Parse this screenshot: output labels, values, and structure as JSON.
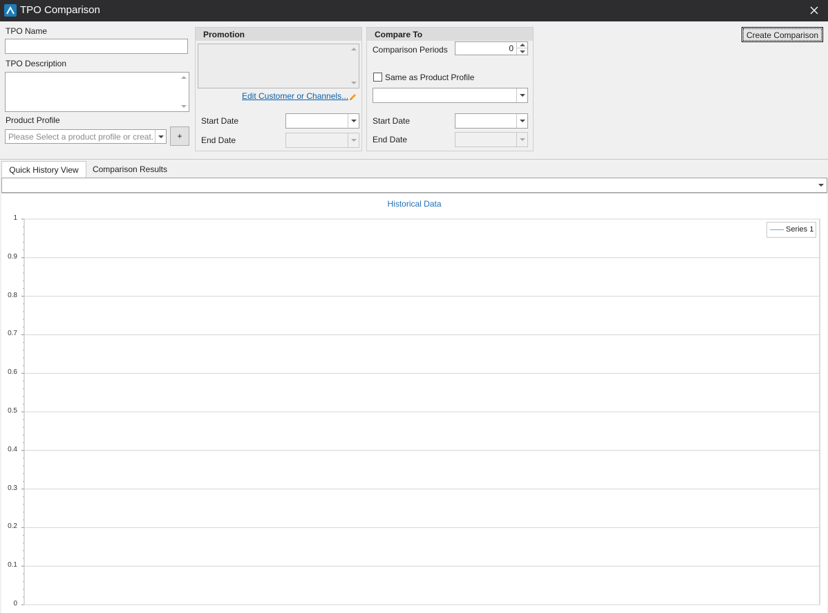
{
  "window": {
    "title": "TPO Comparison"
  },
  "form": {
    "tpo_name_label": "TPO Name",
    "tpo_name_value": "",
    "tpo_description_label": "TPO Description",
    "tpo_description_value": "",
    "product_profile_label": "Product Profile",
    "product_profile_placeholder": "Please Select a product profile or creat...",
    "add_profile_label": "+"
  },
  "promotion": {
    "header": "Promotion",
    "edit_link": "Edit Customer or Channels...",
    "start_date_label": "Start Date",
    "end_date_label": "End Date"
  },
  "compare_to": {
    "header": "Compare To",
    "comparison_periods_label": "Comparison Periods",
    "comparison_periods_value": "0",
    "same_as_profile_label": "Same as Product Profile",
    "start_date_label": "Start Date",
    "end_date_label": "End Date"
  },
  "toolbar": {
    "create_comparison_label": "Create Comparison"
  },
  "tabs": [
    {
      "label": "Quick History View",
      "active": true
    },
    {
      "label": "Comparison Results",
      "active": false
    }
  ],
  "icons": [
    "app-logo-icon",
    "close-icon",
    "pencil-icon",
    "chevron-down-icon"
  ],
  "colors": {
    "titlebar": "#2d2d30",
    "accent": "#1f6fb5",
    "link": "#0b5fa5",
    "series": "#6aa9c9",
    "pencil": "#f0a020"
  },
  "chart_data": {
    "type": "line",
    "title": "Historical Data",
    "xlabel": "",
    "ylabel": "",
    "ylim": [
      0,
      1
    ],
    "yticks": [
      "1",
      "0.9",
      "0.8",
      "0.7",
      "0.6",
      "0.5",
      "0.4",
      "0.3",
      "0.2",
      "0.1",
      "0"
    ],
    "grid": true,
    "legend_position": "top-right",
    "series": [
      {
        "name": "Series 1",
        "values": []
      }
    ]
  }
}
